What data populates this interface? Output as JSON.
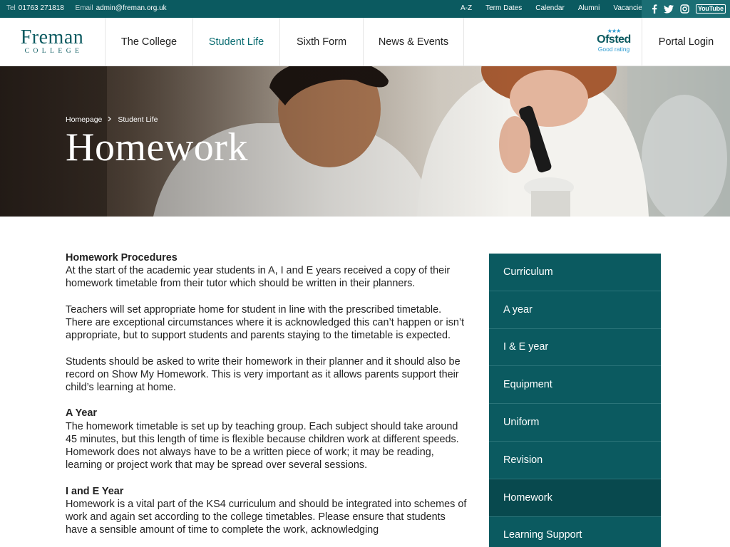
{
  "topbar": {
    "tel_label": "Tel",
    "tel": "01763 271818",
    "email_label": "Email",
    "email": "admin@freman.org.uk",
    "links": [
      "A-Z",
      "Term Dates",
      "Calendar",
      "Alumni",
      "Vacancies"
    ],
    "social": {
      "facebook": "f",
      "twitter": "t",
      "instagram": "◎",
      "youtube": "YouTube"
    }
  },
  "header": {
    "logo_main": "Freman",
    "logo_sub": "COLLEGE",
    "nav": [
      "The College",
      "Student Life",
      "Sixth Form",
      "News & Events"
    ],
    "active_nav": "Student Life",
    "ofsted_name": "Ofsted",
    "ofsted_rating": "Good rating",
    "portal": "Portal Login"
  },
  "hero": {
    "breadcrumb_home": "Homepage",
    "breadcrumb_current": "Student Life",
    "title": "Homework"
  },
  "content": {
    "h1": "Homework Procedures",
    "p1": "At the start of the academic year students in A, I and E years received a copy of their homework timetable from their tutor which should be written in their planners.",
    "p2": "Teachers will set appropriate home for student in line with the prescribed timetable. There are exceptional circumstances where it is acknowledged this can’t happen or isn’t appropriate, but to support students and parents staying to the timetable is expected.",
    "p3": "Students should be asked to write their homework in their planner and it should also be record on Show My Homework. This is very important as it allows parents support their child’s learning at home.",
    "h2": "A Year",
    "p4": "The homework timetable is set up by teaching group. Each subject should take around 45 minutes, but this length of time is flexible because children work at different speeds.  Homework does not always have to be a written piece of work; it may be reading, learning or project work that may be spread over several sessions.",
    "h3": "I and E Year",
    "p5": "Homework is a vital part of the KS4 curriculum and should be integrated into schemes of work and again set according to the college timetables. Please ensure that students have a sensible amount of time to complete the work, acknowledging"
  },
  "sidemenu": {
    "items": [
      "Curriculum",
      "A year",
      "I & E year",
      "Equipment",
      "Uniform",
      "Revision",
      "Homework",
      "Learning Support"
    ],
    "active": "Homework"
  },
  "colors": {
    "brand": "#0b5a60",
    "brand_dark": "#08494e",
    "accent": "#0b6d72"
  }
}
